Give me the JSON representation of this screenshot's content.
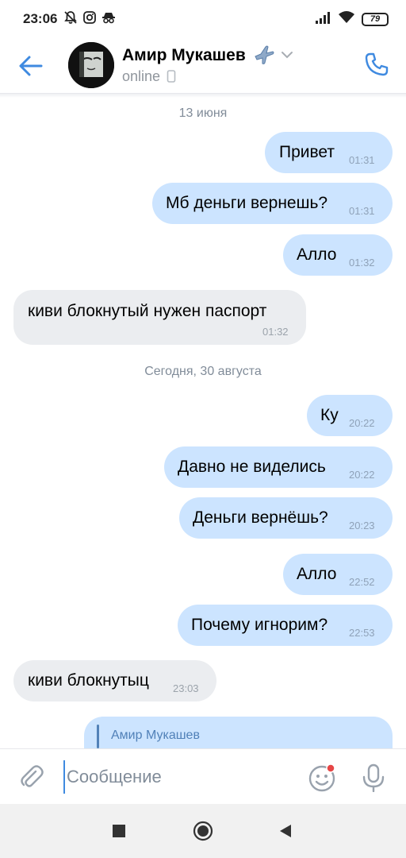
{
  "status_bar": {
    "time": "23:06",
    "battery": "79",
    "icons": [
      "silent-bell-icon",
      "instagram-icon",
      "incognito-icon",
      "signal-icon",
      "wifi-icon",
      "battery-icon"
    ]
  },
  "header": {
    "contact_name": "Амир Мукашев",
    "name_emoji": "✈️",
    "status": "online",
    "icons": [
      "back-arrow-icon",
      "chevron-down-icon",
      "mobile-icon",
      "phone-icon"
    ]
  },
  "chat": {
    "date_1": "13 июня",
    "date_2": "Сегодня, 30 августа",
    "messages": [
      {
        "text": "Привет",
        "time": "01:31",
        "direction": "out"
      },
      {
        "text": "Мб деньги вернешь?",
        "time": "01:31",
        "direction": "out"
      },
      {
        "text": "Алло",
        "time": "01:32",
        "direction": "out"
      },
      {
        "text": "киви блокнутый нужен паспорт",
        "time": "01:32",
        "direction": "in"
      },
      {
        "text": "Ку",
        "time": "20:22",
        "direction": "out"
      },
      {
        "text": "Давно не виделись",
        "time": "20:22",
        "direction": "out"
      },
      {
        "text": "Деньги вернёшь?",
        "time": "20:23",
        "direction": "out"
      },
      {
        "text": "Алло",
        "time": "22:52",
        "direction": "out"
      },
      {
        "text": "Почему игнорим?",
        "time": "22:53",
        "direction": "out"
      },
      {
        "text": "киви блокнутыц",
        "time": "23:03",
        "direction": "in"
      }
    ],
    "reply_preview": {
      "author": "Амир Мукашев"
    }
  },
  "composer": {
    "placeholder": "Сообщение",
    "icons": [
      "paperclip-icon",
      "emoji-icon",
      "microphone-icon"
    ]
  },
  "nav": {
    "icons": [
      "recents-square-icon",
      "home-circle-icon",
      "back-triangle-icon"
    ]
  },
  "colors": {
    "accent": "#3f8ae0",
    "outgoing_bubble": "#cce4ff",
    "incoming_bubble": "#ebedf0",
    "notification_dot": "#e64646"
  }
}
